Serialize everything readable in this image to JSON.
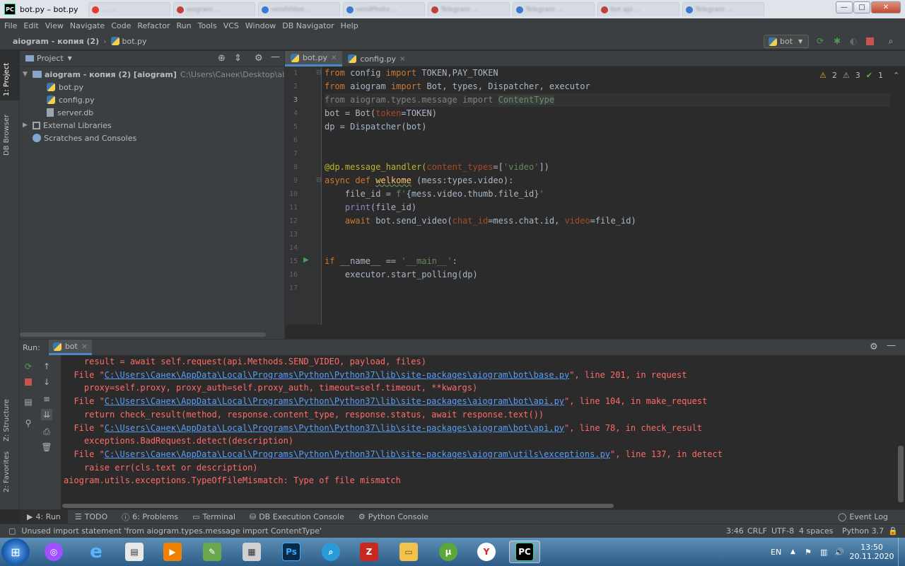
{
  "window": {
    "title": "bot.py – bot.py",
    "controls": {
      "minimize": "—",
      "maximize": "□",
      "close": "✕"
    }
  },
  "browser_tabs": [
    {
      "label": "... ...",
      "color": "#e8382f"
    },
    {
      "label": "aiogram ...",
      "color": "#c04040"
    },
    {
      "label": "sendVideo ...",
      "color": "#3b78d8"
    },
    {
      "label": "sendPhoto ...",
      "color": "#3b78d8"
    },
    {
      "label": "Telegram ...",
      "color": "#c04040"
    },
    {
      "label": "Telegram ...",
      "color": "#3b78d8"
    },
    {
      "label": "bot api ...",
      "color": "#c04040"
    },
    {
      "label": "Telegram ...",
      "color": "#3b78d8"
    }
  ],
  "menu": [
    "File",
    "Edit",
    "View",
    "Navigate",
    "Code",
    "Refactor",
    "Run",
    "Tools",
    "VCS",
    "Window",
    "DB Navigator",
    "Help"
  ],
  "navbar": {
    "project": "aiogram - копия (2)",
    "file": "bot.py",
    "run_config": "bot"
  },
  "left_stripe": {
    "project_tab": "1: Project",
    "db_tab": "DB Browser",
    "structure_tab": "Z: Structure",
    "favorites_tab": "2: Favorites"
  },
  "project_panel": {
    "header": "Project",
    "root_label": "aiogram - копия (2) [aiogram]",
    "root_path": "C:\\Users\\Санек\\Desktop\\aiogram - копи",
    "files": [
      "bot.py",
      "config.py",
      "server.db"
    ],
    "external": "External Libraries",
    "scratches": "Scratches and Consoles"
  },
  "editor": {
    "tabs": [
      "bot.py",
      "config.py"
    ],
    "inspection": {
      "warnings": "2",
      "weak": "3",
      "ok": "1"
    },
    "line_numbers": [
      "1",
      "2",
      "3",
      "4",
      "5",
      "6",
      "7",
      "8",
      "9",
      "10",
      "11",
      "12",
      "13",
      "14",
      "15",
      "16",
      "17"
    ],
    "code": {
      "l1a": "from",
      "l1b": " config ",
      "l1c": "import",
      "l1d": " TOKEN,PAY_TOKEN",
      "l2a": "from",
      "l2b": " aiogram ",
      "l2c": "import",
      "l2d": " Bot, types, Dispatcher, executor",
      "l3a": "from aiogram.types.message import ",
      "l3b": "ContentType",
      "l4a": "bot = Bot(",
      "l4b": "token",
      "l4c": "=TOKEN)",
      "l5": "dp = Dispatcher(bot)",
      "l8a": "@dp.message_handler(",
      "l8b": "content_types",
      "l8c": "=[",
      "l8d": "'video'",
      "l8e": "])",
      "l9a": "async def",
      "l9b": " ",
      "l9c": "welkome",
      "l9d": " (mess:types.video):",
      "l10a": "    file_id = ",
      "l10b": "f'",
      "l10c": "{mess.video.thumb.file_id}",
      "l10d": "'",
      "l11a": "    ",
      "l11b": "print",
      "l11c": "(file_id)",
      "l12a": "    ",
      "l12b": "await",
      "l12c": " bot.send_video(",
      "l12d": "chat_id",
      "l12e": "=mess.chat.id, ",
      "l12f": "video",
      "l12g": "=file_id)",
      "l15a": "if",
      "l15b": " __name__ == ",
      "l15c": "'__main__'",
      "l15d": ":",
      "l16": "    executor.start_polling(dp)"
    }
  },
  "run_panel": {
    "label": "Run:",
    "tab": "bot",
    "lines": {
      "c1": "    result = await self.request(api.Methods.SEND_VIDEO, payload, files)",
      "c2a": "  File \"",
      "c2b": "C:\\Users\\Санек\\AppData\\Local\\Programs\\Python\\Python37\\lib\\site-packages\\aiogram\\bot\\base.py",
      "c2c": "\", line 201, in request",
      "c3": "    proxy=self.proxy, proxy_auth=self.proxy_auth, timeout=self.timeout, **kwargs)",
      "c4a": "  File \"",
      "c4b": "C:\\Users\\Санек\\AppData\\Local\\Programs\\Python\\Python37\\lib\\site-packages\\aiogram\\bot\\api.py",
      "c4c": "\", line 104, in make_request",
      "c5": "    return check_result(method, response.content_type, response.status, await response.text())",
      "c6a": "  File \"",
      "c6b": "C:\\Users\\Санек\\AppData\\Local\\Programs\\Python\\Python37\\lib\\site-packages\\aiogram\\bot\\api.py",
      "c6c": "\", line 78, in check_result",
      "c7": "    exceptions.BadRequest.detect(description)",
      "c8a": "  File \"",
      "c8b": "C:\\Users\\Санек\\AppData\\Local\\Programs\\Python\\Python37\\lib\\site-packages\\aiogram\\utils\\exceptions.py",
      "c8c": "\", line 137, in detect",
      "c9": "    raise err(cls.text or description)",
      "c10": "aiogram.utils.exceptions.TypeOfFileMismatch: Type of file mismatch"
    }
  },
  "tool_tabs": [
    {
      "label": "4: Run"
    },
    {
      "label": "TODO"
    },
    {
      "label": "6: Problems"
    },
    {
      "label": "Terminal"
    },
    {
      "label": "DB Execution Console"
    },
    {
      "label": "Python Console"
    }
  ],
  "event_log": "Event Log",
  "status": {
    "message": "Unused import statement 'from aiogram.types.message import ContentType'",
    "position": "3:46",
    "line_sep": "CRLF",
    "encoding": "UTF-8",
    "indent": "4 spaces",
    "interpreter": "Python 3.7"
  },
  "taskbar": {
    "lang": "EN",
    "time": "13:50",
    "date": "20.11.2020"
  }
}
